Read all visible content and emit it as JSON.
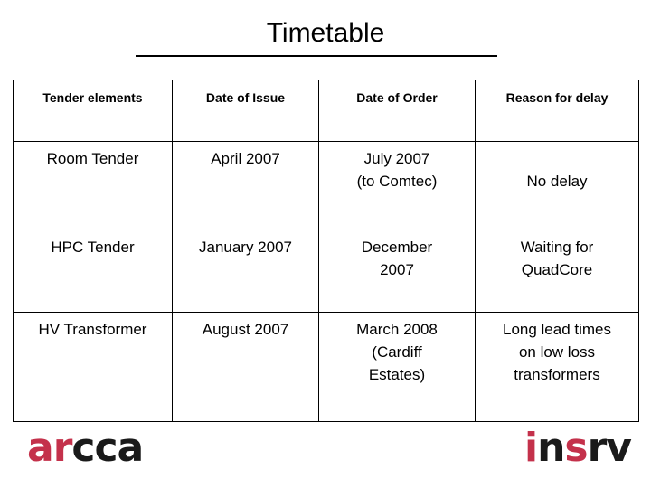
{
  "slide": {
    "title": "Timetable"
  },
  "table": {
    "headers": [
      "Tender elements",
      "Date of Issue",
      "Date of Order",
      "Reason for delay"
    ],
    "rows": [
      {
        "element": "Room Tender",
        "date_of_issue": "April 2007",
        "date_of_order_line1": "July 2007",
        "date_of_order_line2": "(to Comtec)",
        "reason_line1": "No delay",
        "reason_line2": "",
        "reason_line3": ""
      },
      {
        "element": "HPC Tender",
        "date_of_issue": "January 2007",
        "date_of_order_line1": "December",
        "date_of_order_line2": "2007",
        "reason_line1": "Waiting for",
        "reason_line2": "QuadCore",
        "reason_line3": ""
      },
      {
        "element": "HV Transformer",
        "date_of_issue": "August 2007",
        "date_of_order_line1": "March 2008",
        "date_of_order_line2": "(Cardiff",
        "date_of_order_line3": "Estates)",
        "reason_line1": "Long lead times",
        "reason_line2": "on low loss",
        "reason_line3": "transformers"
      }
    ]
  },
  "logos": {
    "arcca": {
      "red_part": "ar",
      "black_part": "cca"
    },
    "insrv": {
      "red_part_1": "i",
      "black_part_1": "n",
      "red_part_2": "s",
      "black_part_2": "rv"
    }
  },
  "colors": {
    "brand_red": "#C4314B",
    "brand_black": "#1A1A1A",
    "rule": "#000000"
  }
}
